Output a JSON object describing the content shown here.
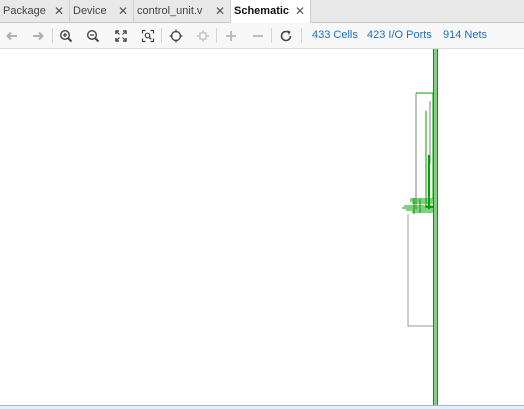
{
  "tabs": [
    {
      "label": "Package",
      "close": "✕"
    },
    {
      "label": "Device",
      "close": "✕"
    },
    {
      "label": "control_unit.v",
      "close": "✕"
    },
    {
      "label": "Schematic",
      "close": "✕"
    }
  ],
  "toolbar": {
    "icons": [
      "back-arrow-icon",
      "forward-arrow-icon",
      "zoom-in-icon",
      "zoom-out-icon",
      "zoom-fit-icon",
      "zoom-area-icon",
      "select-target-icon",
      "regenerate-icon",
      "expand-plus-icon",
      "collapse-minus-icon",
      "refresh-icon"
    ],
    "cells_label": "433 Cells",
    "ports_label": "423 I/O Ports",
    "nets_label": "914 Nets"
  },
  "colors": {
    "net_green": "#00a000",
    "box_gray": "#7f7f7f",
    "link_blue": "#1f6fbf"
  }
}
